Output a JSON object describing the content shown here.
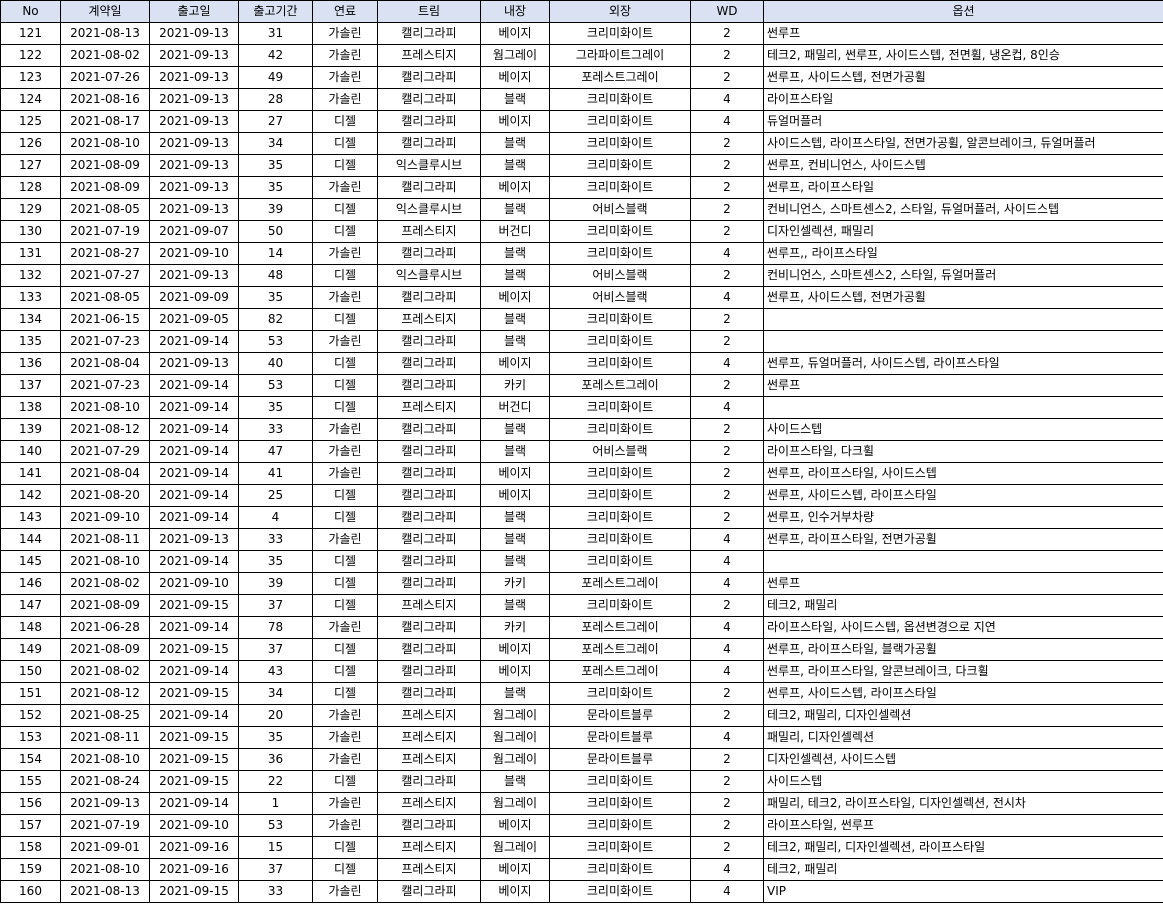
{
  "columns": [
    "No",
    "계약일",
    "출고일",
    "출고기간",
    "연료",
    "트림",
    "내장",
    "외장",
    "WD",
    "옵션"
  ],
  "rows": [
    [
      "121",
      "2021-08-13",
      "2021-09-13",
      "31",
      "가솔린",
      "캘리그라피",
      "베이지",
      "크리미화이트",
      "2",
      "썬루프"
    ],
    [
      "122",
      "2021-08-02",
      "2021-09-13",
      "42",
      "가솔린",
      "프레스티지",
      "웜그레이",
      "그라파이트그레이",
      "2",
      "테크2, 패밀리, 썬루프, 사이드스텝, 전면휠, 냉온컵, 8인승"
    ],
    [
      "123",
      "2021-07-26",
      "2021-09-13",
      "49",
      "가솔린",
      "캘리그라피",
      "베이지",
      "포레스트그레이",
      "2",
      "썬루프, 사이드스텝, 전면가공휠"
    ],
    [
      "124",
      "2021-08-16",
      "2021-09-13",
      "28",
      "가솔린",
      "캘리그라피",
      "블랙",
      "크리미화이트",
      "4",
      "라이프스타일"
    ],
    [
      "125",
      "2021-08-17",
      "2021-09-13",
      "27",
      "디젤",
      "캘리그라피",
      "베이지",
      "크리미화이트",
      "4",
      "듀얼머플러"
    ],
    [
      "126",
      "2021-08-10",
      "2021-09-13",
      "34",
      "디젤",
      "캘리그라피",
      "블랙",
      "크리미화이트",
      "2",
      "사이드스텝, 라이프스타일, 전면가공휠, 알콘브레이크, 듀얼머플러"
    ],
    [
      "127",
      "2021-08-09",
      "2021-09-13",
      "35",
      "디젤",
      "익스클루시브",
      "블랙",
      "크리미화이트",
      "2",
      "썬루프, 컨비니언스, 사이드스텝"
    ],
    [
      "128",
      "2021-08-09",
      "2021-09-13",
      "35",
      "가솔린",
      "캘리그라피",
      "베이지",
      "크리미화이트",
      "2",
      "썬루프, 라이프스타일"
    ],
    [
      "129",
      "2021-08-05",
      "2021-09-13",
      "39",
      "디젤",
      "익스클루시브",
      "블랙",
      "어비스블랙",
      "2",
      "컨비니언스, 스마트센스2, 스타일, 듀얼머플러, 사이드스텝"
    ],
    [
      "130",
      "2021-07-19",
      "2021-09-07",
      "50",
      "디젤",
      "프레스티지",
      "버건디",
      "크리미화이트",
      "2",
      "디자인셀렉션, 패밀리"
    ],
    [
      "131",
      "2021-08-27",
      "2021-09-10",
      "14",
      "가솔린",
      "캘리그라피",
      "블랙",
      "크리미화이트",
      "4",
      "썬루프,, 라이프스타일"
    ],
    [
      "132",
      "2021-07-27",
      "2021-09-13",
      "48",
      "디젤",
      "익스클루시브",
      "블랙",
      "어비스블랙",
      "2",
      "컨비니언스, 스마트센스2, 스타일, 듀얼머플러"
    ],
    [
      "133",
      "2021-08-05",
      "2021-09-09",
      "35",
      "가솔린",
      "캘리그라피",
      "베이지",
      "어비스블랙",
      "4",
      "썬루프, 사이드스텝, 전면가공휠"
    ],
    [
      "134",
      "2021-06-15",
      "2021-09-05",
      "82",
      "디젤",
      "프레스티지",
      "블랙",
      "크리미화이트",
      "2",
      ""
    ],
    [
      "135",
      "2021-07-23",
      "2021-09-14",
      "53",
      "가솔린",
      "캘리그라피",
      "블랙",
      "크리미화이트",
      "2",
      ""
    ],
    [
      "136",
      "2021-08-04",
      "2021-09-13",
      "40",
      "디젤",
      "캘리그라피",
      "베이지",
      "크리미화이트",
      "4",
      "썬루프, 듀얼머플러, 사이드스텝, 라이프스타일"
    ],
    [
      "137",
      "2021-07-23",
      "2021-09-14",
      "53",
      "디젤",
      "캘리그라피",
      "카키",
      "포레스트그레이",
      "2",
      "썬루프"
    ],
    [
      "138",
      "2021-08-10",
      "2021-09-14",
      "35",
      "디젤",
      "프레스티지",
      "버건디",
      "크리미화이트",
      "4",
      ""
    ],
    [
      "139",
      "2021-08-12",
      "2021-09-14",
      "33",
      "가솔린",
      "캘리그라피",
      "블랙",
      "크리미화이트",
      "2",
      "사이드스텝"
    ],
    [
      "140",
      "2021-07-29",
      "2021-09-14",
      "47",
      "가솔린",
      "캘리그라피",
      "블랙",
      "어비스블랙",
      "2",
      "라이프스타일, 다크휠"
    ],
    [
      "141",
      "2021-08-04",
      "2021-09-14",
      "41",
      "가솔린",
      "캘리그라피",
      "베이지",
      "크리미화이트",
      "2",
      "썬루프, 라이프스타일, 사이드스텝"
    ],
    [
      "142",
      "2021-08-20",
      "2021-09-14",
      "25",
      "디젤",
      "캘리그라피",
      "베이지",
      "크리미화이트",
      "2",
      "썬루프, 사이드스텝, 라이프스타일"
    ],
    [
      "143",
      "2021-09-10",
      "2021-09-14",
      "4",
      "디젤",
      "캘리그라피",
      "블랙",
      "크리미화이트",
      "2",
      "썬루프, 인수거부차량"
    ],
    [
      "144",
      "2021-08-11",
      "2021-09-13",
      "33",
      "가솔린",
      "캘리그라피",
      "블랙",
      "크리미화이트",
      "4",
      "썬루프, 라이프스타일, 전면가공휠"
    ],
    [
      "145",
      "2021-08-10",
      "2021-09-14",
      "35",
      "디젤",
      "캘리그라피",
      "블랙",
      "크리미화이트",
      "4",
      ""
    ],
    [
      "146",
      "2021-08-02",
      "2021-09-10",
      "39",
      "디젤",
      "캘리그라피",
      "카키",
      "포레스트그레이",
      "4",
      "썬루프"
    ],
    [
      "147",
      "2021-08-09",
      "2021-09-15",
      "37",
      "디젤",
      "프레스티지",
      "블랙",
      "크리미화이트",
      "2",
      "테크2, 패밀리"
    ],
    [
      "148",
      "2021-06-28",
      "2021-09-14",
      "78",
      "가솔린",
      "캘리그라피",
      "카키",
      "포레스트그레이",
      "4",
      "라이프스타일, 사이드스텝, 옵션변경으로 지연"
    ],
    [
      "149",
      "2021-08-09",
      "2021-09-15",
      "37",
      "디젤",
      "캘리그라피",
      "베이지",
      "포레스트그레이",
      "4",
      "썬루프, 라이프스타일, 블랙가공휠"
    ],
    [
      "150",
      "2021-08-02",
      "2021-09-14",
      "43",
      "디젤",
      "캘리그라피",
      "베이지",
      "포레스트그레이",
      "4",
      "썬루프, 라이프스타일, 알콘브레이크, 다크휠"
    ],
    [
      "151",
      "2021-08-12",
      "2021-09-15",
      "34",
      "디젤",
      "캘리그라피",
      "블랙",
      "크리미화이트",
      "2",
      "썬루프, 사이드스텝, 라이프스타일"
    ],
    [
      "152",
      "2021-08-25",
      "2021-09-14",
      "20",
      "가솔린",
      "프레스티지",
      "웜그레이",
      "문라이트블루",
      "2",
      "테크2, 패밀리, 디자인셀렉션"
    ],
    [
      "153",
      "2021-08-11",
      "2021-09-15",
      "35",
      "가솔린",
      "프레스티지",
      "웜그레이",
      "문라이트블루",
      "4",
      "패밀리, 디자인셀렉션"
    ],
    [
      "154",
      "2021-08-10",
      "2021-09-15",
      "36",
      "가솔린",
      "프레스티지",
      "웜그레이",
      "문라이트블루",
      "2",
      "디자인셀렉션, 사이드스텝"
    ],
    [
      "155",
      "2021-08-24",
      "2021-09-15",
      "22",
      "디젤",
      "캘리그라피",
      "블랙",
      "크리미화이트",
      "2",
      "사이드스텝"
    ],
    [
      "156",
      "2021-09-13",
      "2021-09-14",
      "1",
      "가솔린",
      "프레스티지",
      "웜그레이",
      "크리미화이트",
      "2",
      "패밀리, 테크2, 라이프스타일, 디자인셀렉션, 전시차"
    ],
    [
      "157",
      "2021-07-19",
      "2021-09-10",
      "53",
      "가솔린",
      "캘리그라피",
      "베이지",
      "크리미화이트",
      "2",
      "라이프스타일, 썬루프"
    ],
    [
      "158",
      "2021-09-01",
      "2021-09-16",
      "15",
      "디젤",
      "프레스티지",
      "웜그레이",
      "크리미화이트",
      "2",
      "테크2, 패밀리, 디자인셀렉션, 라이프스타일"
    ],
    [
      "159",
      "2021-08-10",
      "2021-09-16",
      "37",
      "디젤",
      "프레스티지",
      "베이지",
      "크리미화이트",
      "4",
      "테크2, 패밀리"
    ],
    [
      "160",
      "2021-08-13",
      "2021-09-15",
      "33",
      "가솔린",
      "캘리그라피",
      "베이지",
      "크리미화이트",
      "4",
      "VIP"
    ]
  ]
}
